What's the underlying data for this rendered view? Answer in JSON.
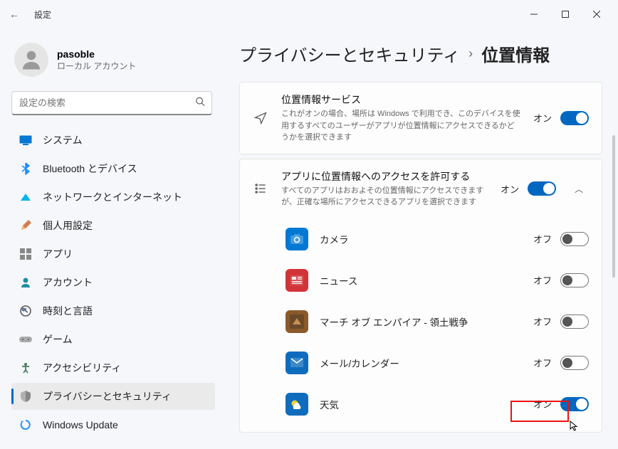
{
  "window": {
    "title": "設定"
  },
  "user": {
    "name": "pasoble",
    "sub": "ローカル アカウント"
  },
  "search": {
    "placeholder": "設定の検索"
  },
  "nav": [
    {
      "id": "system",
      "label": "システム"
    },
    {
      "id": "bluetooth",
      "label": "Bluetooth とデバイス"
    },
    {
      "id": "network",
      "label": "ネットワークとインターネット"
    },
    {
      "id": "personalize",
      "label": "個人用設定"
    },
    {
      "id": "apps",
      "label": "アプリ"
    },
    {
      "id": "accounts",
      "label": "アカウント"
    },
    {
      "id": "time",
      "label": "時刻と言語"
    },
    {
      "id": "gaming",
      "label": "ゲーム"
    },
    {
      "id": "accessibility",
      "label": "アクセシビリティ"
    },
    {
      "id": "privacy",
      "label": "プライバシーとセキュリティ",
      "selected": true
    },
    {
      "id": "update",
      "label": "Windows Update"
    }
  ],
  "breadcrumb": {
    "parent": "プライバシーとセキュリティ",
    "sep": "›",
    "current": "位置情報"
  },
  "sections": {
    "location_service": {
      "title": "位置情報サービス",
      "sub": "これがオンの場合、場所は Windows で利用でき、このデバイスを使用するすべてのユーザーがアプリが位置情報にアクセスできるかどうかを選択できます",
      "state_label": "オン"
    },
    "app_access": {
      "title": "アプリに位置情報へのアクセスを許可する",
      "sub": "すべてのアプリはおおよその位置情報にアクセスできますが、正確な場所にアクセスできるアプリを選択できます",
      "state_label": "オン"
    }
  },
  "apps": [
    {
      "id": "camera",
      "label": "カメラ",
      "state_label": "オフ",
      "on": false,
      "bg": "#0078d4"
    },
    {
      "id": "news",
      "label": "ニュース",
      "state_label": "オフ",
      "on": false,
      "bg": "#d13438"
    },
    {
      "id": "march",
      "label": "マーチ オブ エンパイア - 領土戦争",
      "state_label": "オフ",
      "on": false,
      "bg": "#8b5a2b"
    },
    {
      "id": "mail",
      "label": "メール/カレンダー",
      "state_label": "オフ",
      "on": false,
      "bg": "#0f6cbd"
    },
    {
      "id": "weather",
      "label": "天気",
      "state_label": "オン",
      "on": true,
      "bg": "#0f6cbd"
    }
  ]
}
